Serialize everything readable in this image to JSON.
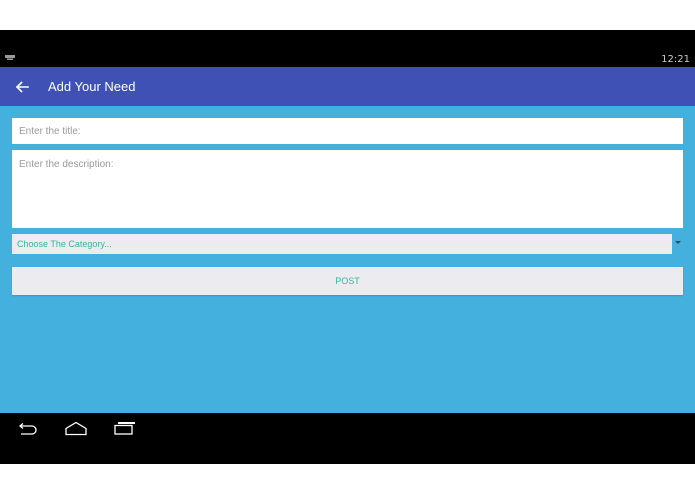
{
  "status_bar": {
    "time": "12:21",
    "notification_icon": "keyboard-notification-icon"
  },
  "app_bar": {
    "back_icon": "arrow-back-icon",
    "title": "Add Your Need",
    "color": "#3f51b5"
  },
  "form": {
    "title_placeholder": "Enter the title:",
    "description_placeholder": "Enter the description:",
    "category_selected": "Choose The Category...",
    "post_label": "POST",
    "background": "#44b0de",
    "accent": "#37b59c"
  },
  "nav_bar": {
    "back_icon": "nav-back-icon",
    "home_icon": "nav-home-icon",
    "recents_icon": "nav-recents-icon"
  }
}
